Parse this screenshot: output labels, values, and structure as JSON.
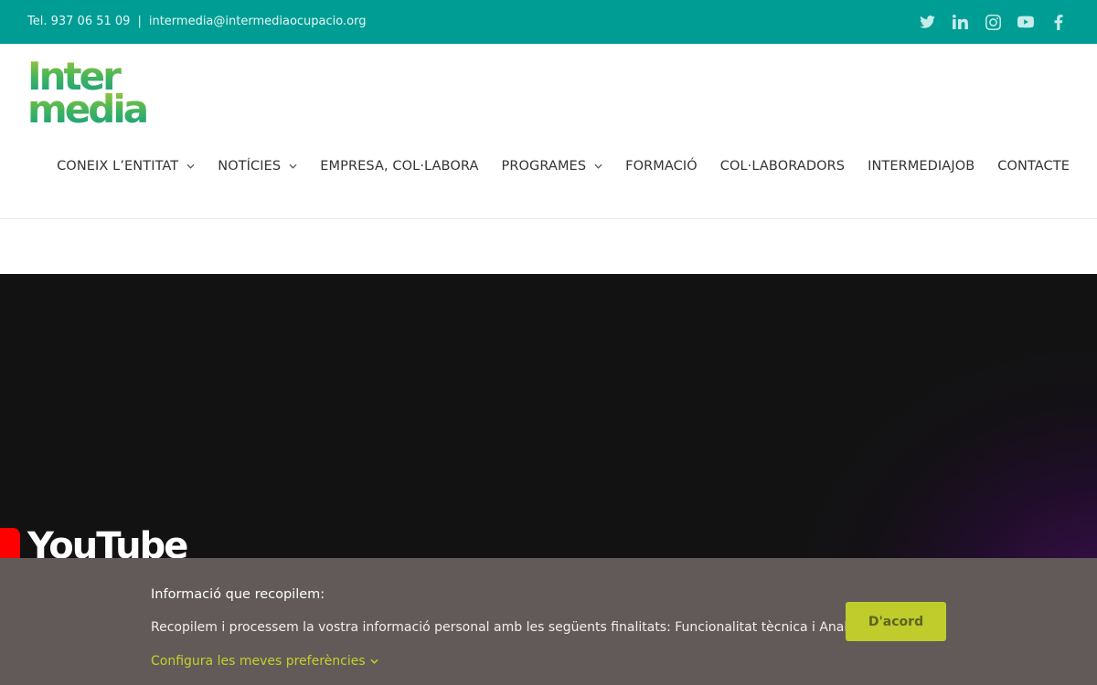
{
  "topbar": {
    "phone": "Tel. 937 06 51 09",
    "separator": "|",
    "email": "intermedia@intermediaocupacio.org",
    "social_icons": [
      "twitter-icon",
      "linkedin-icon",
      "instagram-icon",
      "youtube-icon",
      "facebook-icon"
    ]
  },
  "logo": {
    "line1": "Inter",
    "line2": "media"
  },
  "nav": {
    "items": [
      {
        "label": "CONEIX L’ENTITAT",
        "dropdown": true
      },
      {
        "label": "NOTÍCIES",
        "dropdown": true
      },
      {
        "label": "EMPRESA, COL·LABORA",
        "dropdown": false
      },
      {
        "label": "PROGRAMES",
        "dropdown": true
      },
      {
        "label": "FORMACIÓ",
        "dropdown": false
      },
      {
        "label": "COL·LABORADORS",
        "dropdown": false
      },
      {
        "label": "INTERMEDIAJOB",
        "dropdown": false
      },
      {
        "label": "CONTACTE",
        "dropdown": false
      }
    ]
  },
  "video": {
    "brand": "YouTube"
  },
  "cookie": {
    "title": "Informació que recopilem:",
    "text": "Recopilem i processem la vostra informació personal amb les següents finalitats: Funcionalitat tècnica i Analítica web.",
    "config_link": "Configura les meves preferències",
    "accept_label": "D'acord"
  },
  "colors": {
    "topbar": "#009d94",
    "cookie_bg": "#625a58",
    "accent_green": "#bfcc2b",
    "logo_green_light": "#a9c932",
    "logo_green_dark": "#0e9c8a"
  }
}
